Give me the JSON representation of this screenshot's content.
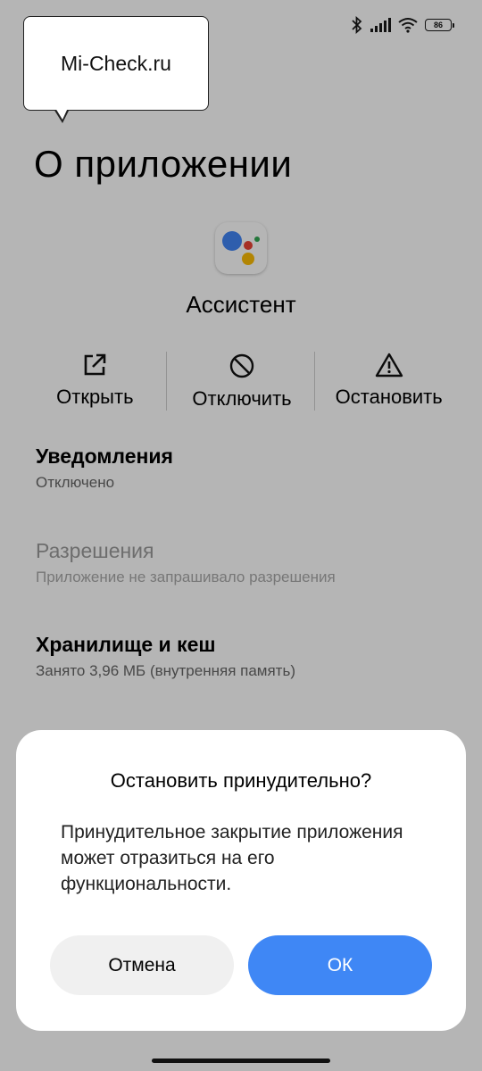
{
  "watermark": "Mi-Check.ru",
  "status_bar": {
    "battery": "86",
    "icons": [
      "bluetooth-icon",
      "signal-icon",
      "wifi-icon",
      "battery-icon"
    ]
  },
  "page": {
    "title": "О приложении",
    "app_name": "Ассистент",
    "app_icon": "google-assistant-icon",
    "actions": [
      {
        "label": "Открыть",
        "icon": "open-external-icon"
      },
      {
        "label": "Отключить",
        "icon": "disable-icon"
      },
      {
        "label": "Остановить",
        "icon": "warning-icon"
      }
    ],
    "items": [
      {
        "title": "Уведомления",
        "subtitle": "Отключено",
        "enabled": true
      },
      {
        "title": "Разрешения",
        "subtitle": "Приложение не запрашивало разрешения",
        "enabled": false
      },
      {
        "title": "Хранилище и кеш",
        "subtitle": "Занято 3,96 МБ (внутренняя память)",
        "enabled": true
      }
    ]
  },
  "dialog": {
    "title": "Остановить принудительно?",
    "message": "Принудительное закрытие приложения может отразиться на его функциональности.",
    "cancel_label": "Отмена",
    "ok_label": "ОК"
  },
  "colors": {
    "accent": "#3f87f5",
    "assistant_blue": "#4285f4",
    "assistant_red": "#ea4335",
    "assistant_yellow": "#fbbc05",
    "assistant_green": "#34a853"
  }
}
